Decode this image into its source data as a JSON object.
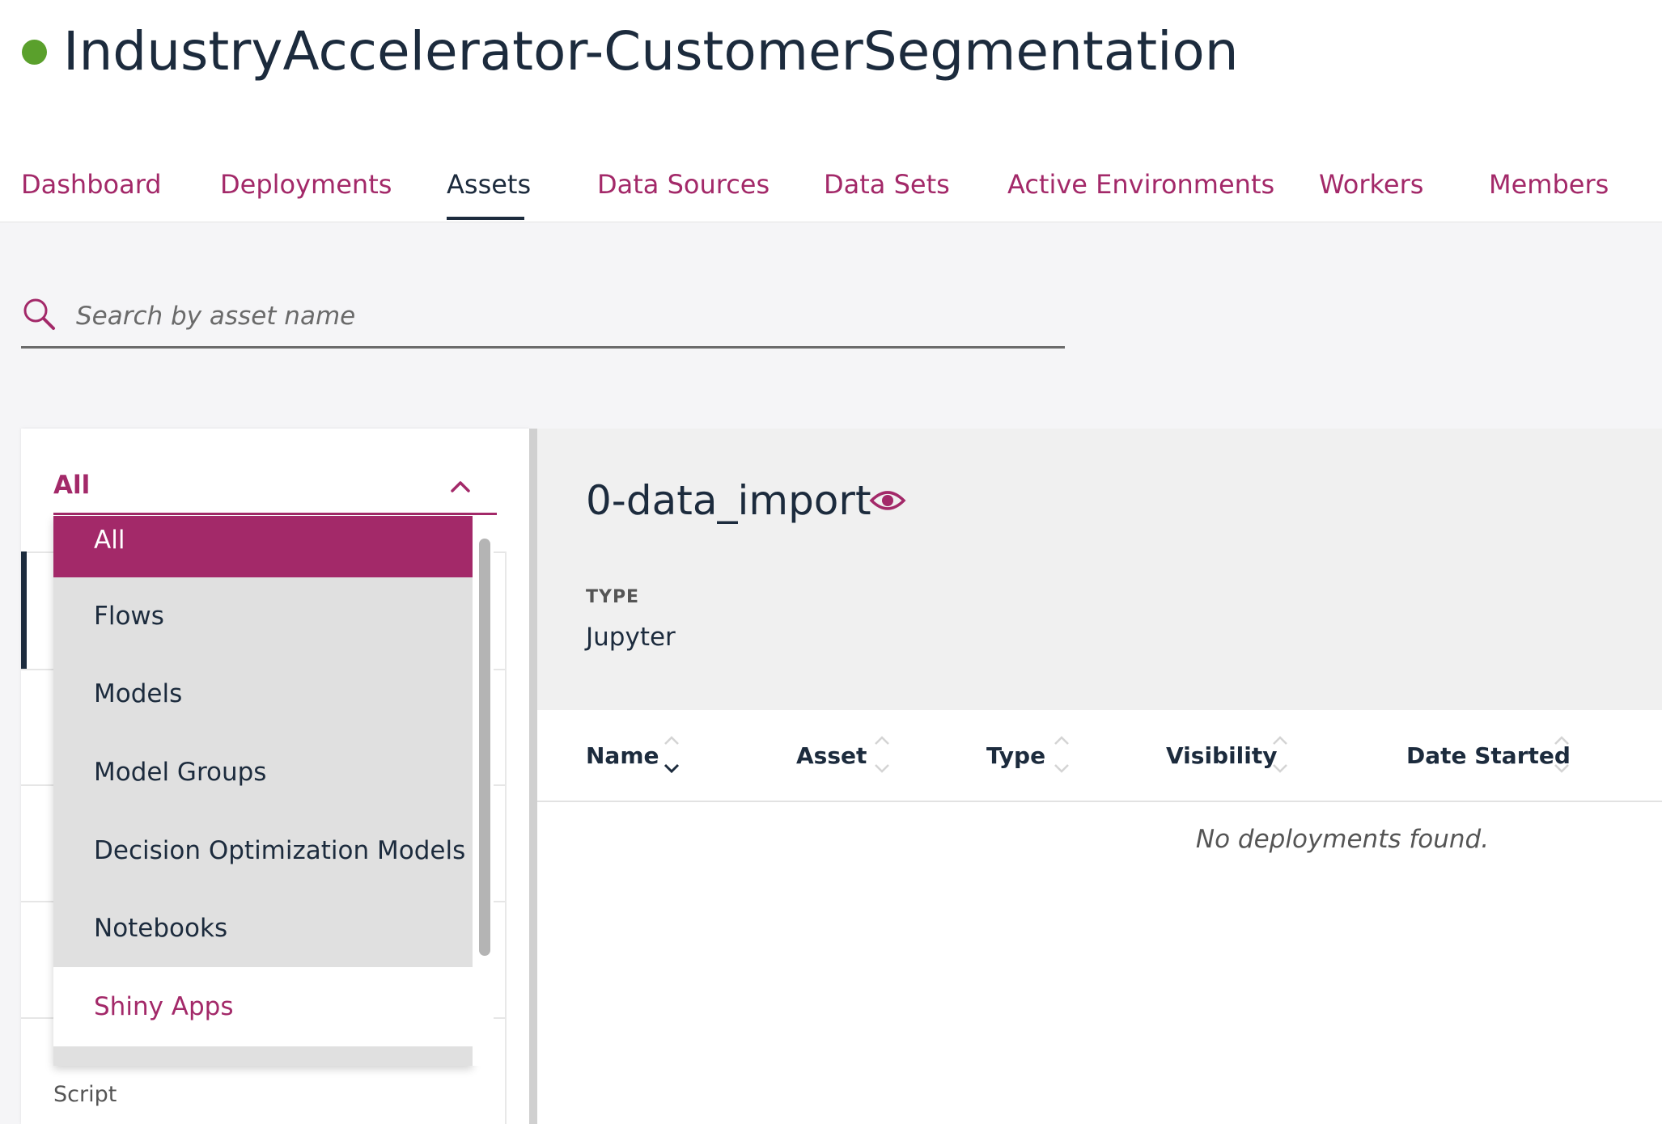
{
  "project": {
    "title": "IndustryAccelerator-CustomerSegmentation",
    "status_color": "#5aa02c"
  },
  "tabs": [
    {
      "label": "Dashboard",
      "active": false
    },
    {
      "label": "Deployments",
      "active": false
    },
    {
      "label": "Assets",
      "active": true
    },
    {
      "label": "Data Sources",
      "active": false
    },
    {
      "label": "Data Sets",
      "active": false
    },
    {
      "label": "Active Environments",
      "active": false
    },
    {
      "label": "Workers",
      "active": false
    },
    {
      "label": "Members",
      "active": false
    }
  ],
  "search": {
    "placeholder": "Search by asset name",
    "value": ""
  },
  "filter": {
    "selected": "All",
    "options": [
      {
        "label": "All",
        "state": "selected"
      },
      {
        "label": "Flows",
        "state": "normal"
      },
      {
        "label": "Models",
        "state": "normal"
      },
      {
        "label": "Model Groups",
        "state": "normal"
      },
      {
        "label": "Decision Optimization Models",
        "state": "normal"
      },
      {
        "label": "Notebooks",
        "state": "normal"
      },
      {
        "label": "Shiny Apps",
        "state": "hover"
      }
    ]
  },
  "asset_list": {
    "visible_type_label": "Script"
  },
  "details": {
    "asset_name": "0-data_import",
    "type_label": "TYPE",
    "type_value": "Jupyter"
  },
  "table": {
    "columns": [
      "Name",
      "Asset",
      "Type",
      "Visibility",
      "Date Started"
    ],
    "empty_message": "No deployments found."
  },
  "colors": {
    "accent": "#a32969",
    "text": "#1c2b3d",
    "background": "#f5f5f7"
  }
}
